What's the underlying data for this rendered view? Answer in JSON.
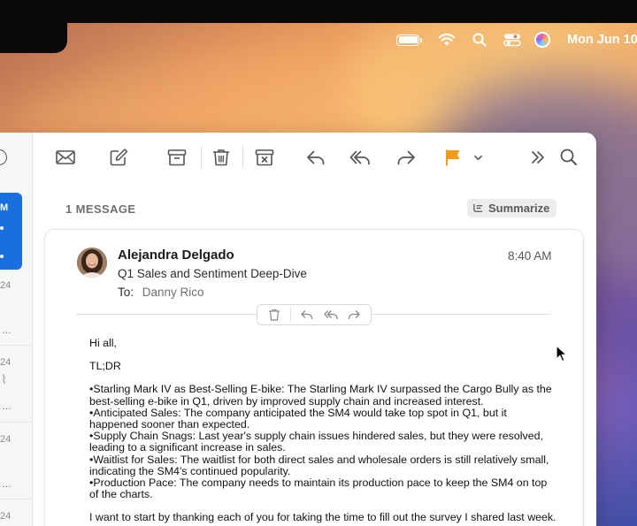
{
  "menubar": {
    "battery_icon": "battery-icon",
    "wifi_icon": "wifi-icon",
    "search_icon": "search-icon",
    "control_center_icon": "control-center-icon",
    "siri_icon": "siri-icon",
    "clock": "Mon Jun 10"
  },
  "sidebar": {
    "selected_initial": "M",
    "dates": [
      "24",
      "24",
      "24",
      "24"
    ]
  },
  "toolbar": {
    "buttons": [
      "envelope-icon",
      "compose-icon",
      "archive-icon",
      "trash-icon",
      "junk-icon",
      "reply-icon",
      "reply-all-icon",
      "forward-icon",
      "flag-icon",
      "chevron-down-icon",
      "more-icon",
      "search-icon"
    ],
    "flag_color": "#f39c1a"
  },
  "thread": {
    "count_label": "1 MESSAGE",
    "summarize_label": "Summarize"
  },
  "message": {
    "sender": "Alejandra Delgado",
    "subject": "Q1 Sales and Sentiment Deep-Dive",
    "to_label": "To:",
    "to_name": "Danny Rico",
    "time": "8:40 AM",
    "greeting": "Hi all,",
    "tldr": "TL;DR",
    "bullets": "•Starling Mark IV as Best-Selling E-bike: The Starling Mark IV surpassed the Cargo Bully as the best-selling e-bike in Q1, driven by improved supply chain and increased interest.\n•Anticipated Sales: The company anticipated the SM4 would take top spot in Q1, but it happened sooner than expected.\n•Supply Chain Snags: Last year's supply chain issues hindered sales, but they were resolved, leading to a significant increase in sales.\n•Waitlist for Sales: The waitlist for both direct sales and wholesale orders is still relatively small, indicating the SM4's continued popularity.\n•Production Pace: The company needs to maintain its production pace to keep the SM4 on top of the charts.",
    "closing": "I want to start by thanking each of you for taking the time to fill out the survey I shared last week."
  },
  "colors": {
    "accent": "#1a6fe0",
    "flag": "#f39c1a"
  }
}
